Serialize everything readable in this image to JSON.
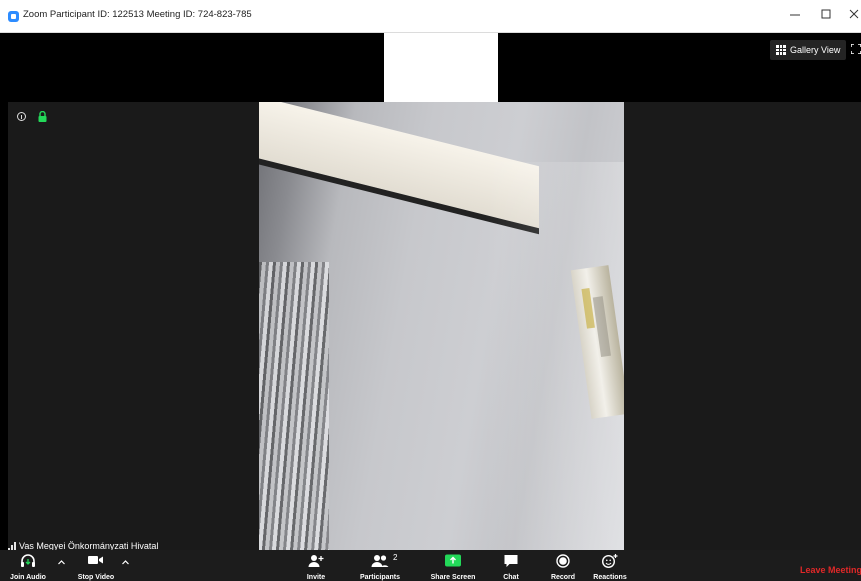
{
  "window": {
    "title": "Zoom Participant ID: 122513   Meeting ID: 724-823-785",
    "minimize_icon": "minimize-icon",
    "maximize_icon": "maximize-icon",
    "close_icon": "close-icon"
  },
  "top_bar": {
    "gallery_view_label": "Gallery View"
  },
  "video": {
    "participant_name": "Vas Megyei Önkormányzati Hivatal"
  },
  "toolbar": {
    "join_audio_label": "Join Audio",
    "stop_video_label": "Stop Video",
    "invite_label": "Invite",
    "participants_label": "Participants",
    "participants_count": "2",
    "share_screen_label": "Share Screen",
    "chat_label": "Chat",
    "record_label": "Record",
    "reactions_label": "Reactions",
    "leave_label": "Leave Meeting"
  },
  "colors": {
    "share_green": "#23d959",
    "leave_red": "#e02828",
    "lock_green": "#23d959",
    "zoom_blue": "#2d8cff"
  }
}
